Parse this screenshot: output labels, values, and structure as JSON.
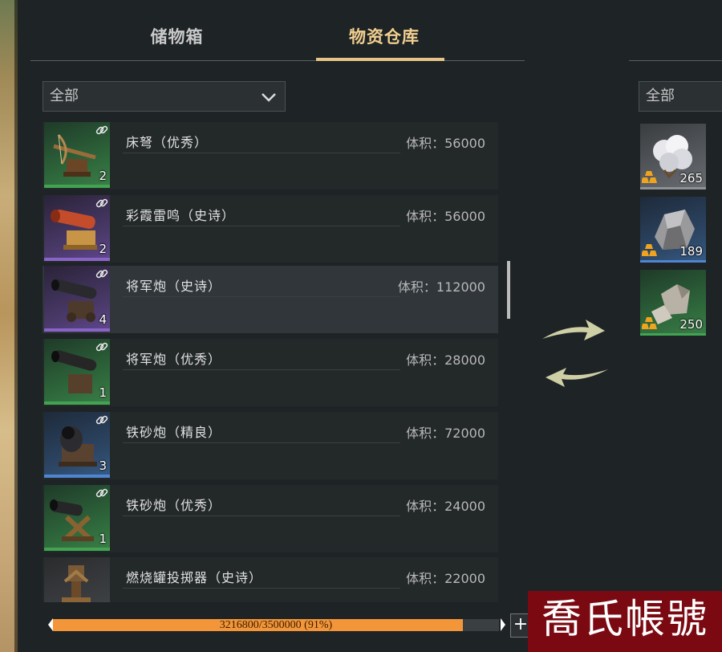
{
  "tabs": [
    {
      "label": "储物箱",
      "active": false
    },
    {
      "label": "物资仓库",
      "active": true
    }
  ],
  "filter_left": {
    "value": "全部",
    "icon": "chevron-down-icon"
  },
  "filter_right": {
    "value": "全部"
  },
  "items": [
    {
      "name": "床弩（优秀）",
      "volume": "体积：56000",
      "count": "2",
      "rarity": "green",
      "icon": "ballista-icon",
      "linked": true
    },
    {
      "name": "彩霞雷鸣（史诗）",
      "volume": "体积：56000",
      "count": "2",
      "rarity": "purple",
      "icon": "cannon-icon",
      "linked": true
    },
    {
      "name": "将军炮（史诗）",
      "volume": "体积：112000",
      "count": "4",
      "rarity": "purple",
      "icon": "cannon-icon",
      "linked": true,
      "selected": true
    },
    {
      "name": "将军炮（优秀）",
      "volume": "体积：28000",
      "count": "1",
      "rarity": "green",
      "icon": "cannon-icon",
      "linked": true
    },
    {
      "name": "铁砂炮（精良）",
      "volume": "体积：72000",
      "count": "3",
      "rarity": "blue",
      "icon": "mortar-icon",
      "linked": true
    },
    {
      "name": "铁砂炮（优秀）",
      "volume": "体积：24000",
      "count": "1",
      "rarity": "green",
      "icon": "mortar-icon",
      "linked": true
    },
    {
      "name": "燃烧罐投掷器（史诗）",
      "volume": "体积：22000",
      "count": "",
      "rarity": "plain",
      "icon": "catapult-icon",
      "linked": false
    }
  ],
  "resources": [
    {
      "count": "265",
      "rarity": "plain",
      "icon": "cotton-icon"
    },
    {
      "count": "189",
      "rarity": "blue",
      "icon": "ore-icon"
    },
    {
      "count": "250",
      "rarity": "green",
      "icon": "stone-icon"
    }
  ],
  "capacity": {
    "text": "3216800/3500000 (91%)",
    "fraction": 0.919
  },
  "colors": {
    "accent": "#e6c488",
    "capacity_fill": "#f3963a",
    "green": "#41a451",
    "purple": "#8a63c8",
    "blue": "#4f85d1"
  },
  "watermark": "喬氏帳號"
}
